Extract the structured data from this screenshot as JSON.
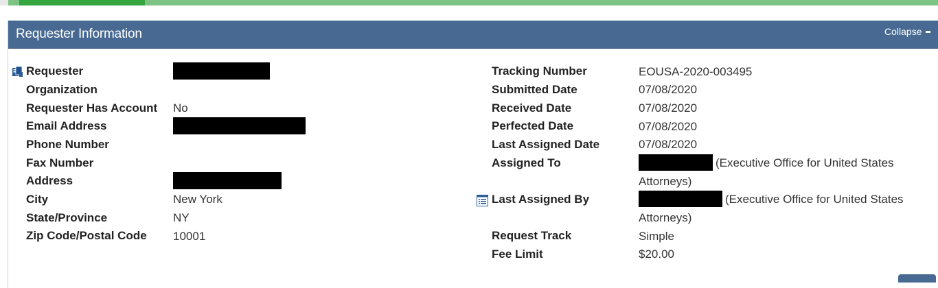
{
  "panel": {
    "title": "Requester Information",
    "collapse_label": "Collapse"
  },
  "left": [
    {
      "label": "Requester",
      "value": "",
      "redacted": true
    },
    {
      "label": "Organization",
      "value": ""
    },
    {
      "label": "Requester Has Account",
      "value": "No"
    },
    {
      "label": "Email Address",
      "value": "",
      "redacted": true
    },
    {
      "label": "Phone Number",
      "value": ""
    },
    {
      "label": "Fax Number",
      "value": ""
    },
    {
      "label": "Address",
      "value": "",
      "redacted": true
    },
    {
      "label": "City",
      "value": "New York"
    },
    {
      "label": "State/Province",
      "value": "NY"
    },
    {
      "label": "Zip Code/Postal Code",
      "value": "10001"
    }
  ],
  "right": {
    "tracking_number": {
      "label": "Tracking Number",
      "value": "EOUSA-2020-003495"
    },
    "submitted_date": {
      "label": "Submitted Date",
      "value": "07/08/2020"
    },
    "received_date": {
      "label": "Received Date",
      "value": "07/08/2020"
    },
    "perfected_date": {
      "label": "Perfected Date",
      "value": "07/08/2020"
    },
    "last_assigned_date": {
      "label": "Last Assigned Date",
      "value": "07/08/2020"
    },
    "assigned_to": {
      "label": "Assigned To",
      "org_line1": "(Executive Office for United States",
      "org_line2": "Attorneys)"
    },
    "last_assigned_by": {
      "label": "Last Assigned By",
      "org_line1": "(Executive Office for United States",
      "org_line2": "Attorneys)"
    },
    "request_track": {
      "label": "Request Track",
      "value": "Simple"
    },
    "fee_limit": {
      "label": "Fee Limit",
      "value": "$20.00"
    }
  },
  "colors": {
    "header_bg": "#486a92",
    "progress_done": "#35a540",
    "progress_rest": "#7dc383"
  },
  "icons": {
    "requester": "requester-card-icon",
    "last_assigned_by": "history-list-icon"
  }
}
